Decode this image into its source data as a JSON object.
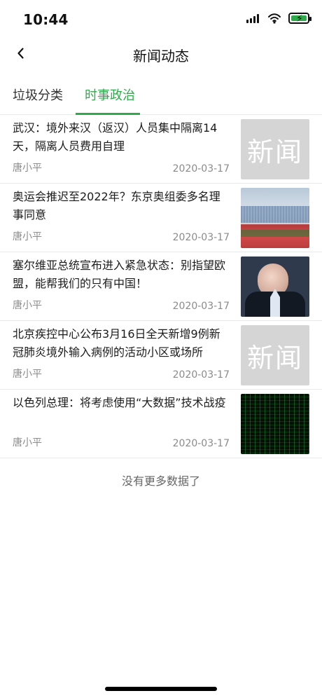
{
  "status_bar": {
    "time": "10:44",
    "icons": [
      "signal-icon",
      "wifi-icon",
      "battery-charging-icon"
    ],
    "battery_color": "#2eaa4a"
  },
  "nav": {
    "title": "新闻动态",
    "back_icon": "chevron-left-icon"
  },
  "tabs": {
    "items": [
      {
        "label": "垃圾分类",
        "selected": false
      },
      {
        "label": "时事政治",
        "selected": true
      }
    ],
    "accent": "#2eaa4a"
  },
  "news": [
    {
      "headline": "武汉：境外来汉（返汉）人员集中隔离14天，隔离人员费用自理",
      "author": "唐小平",
      "date": "2020-03-17",
      "thumb": {
        "type": "text",
        "text": "新闻"
      }
    },
    {
      "headline": "奥运会推迟至2022年？东京奥组委多名理事同意",
      "author": "唐小平",
      "date": "2020-03-17",
      "thumb": {
        "type": "image",
        "name": "stadium-image"
      }
    },
    {
      "headline": "塞尔维亚总统宣布进入紧急状态：别指望欧盟，能帮我们的只有中国！",
      "author": "唐小平",
      "date": "2020-03-17",
      "thumb": {
        "type": "image",
        "name": "person-image"
      }
    },
    {
      "headline": "北京疾控中心公布3月16日全天新增9例新冠肺炎境外输入病例的活动小区或场所",
      "author": "唐小平",
      "date": "2020-03-17",
      "thumb": {
        "type": "text",
        "text": "新闻"
      }
    },
    {
      "headline": "以色列总理：将考虑使用“大数据”技术战疫",
      "author": "唐小平",
      "date": "2020-03-17",
      "thumb": {
        "type": "image",
        "name": "matrix-image"
      }
    }
  ],
  "footer": {
    "text": "没有更多数据了"
  }
}
